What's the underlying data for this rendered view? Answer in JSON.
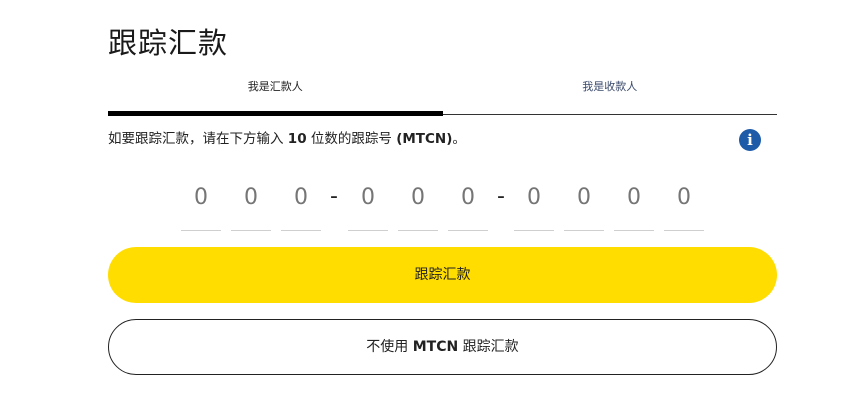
{
  "page": {
    "title": "跟踪汇款"
  },
  "tabs": [
    {
      "label": "我是汇款人",
      "active": true
    },
    {
      "label": "我是收款人",
      "active": false
    }
  ],
  "instruction": {
    "prefix": "如要跟踪汇款，请在下方输入 ",
    "count": "10",
    "middle": " 位数的跟踪号 ",
    "code": "(MTCN)",
    "suffix": "。"
  },
  "info": {
    "icon": "info-icon",
    "glyph": "i",
    "color": "#1d5aa8"
  },
  "mtcn": {
    "placeholders": [
      "0",
      "0",
      "0",
      "0",
      "0",
      "0",
      "0",
      "0",
      "0",
      "0"
    ],
    "separator": "-"
  },
  "buttons": {
    "track_label": "跟踪汇款",
    "track_color": "#ffdd00",
    "no_mtcn_prefix": "不使用 ",
    "no_mtcn_code": "MTCN",
    "no_mtcn_suffix": " 跟踪汇款"
  }
}
